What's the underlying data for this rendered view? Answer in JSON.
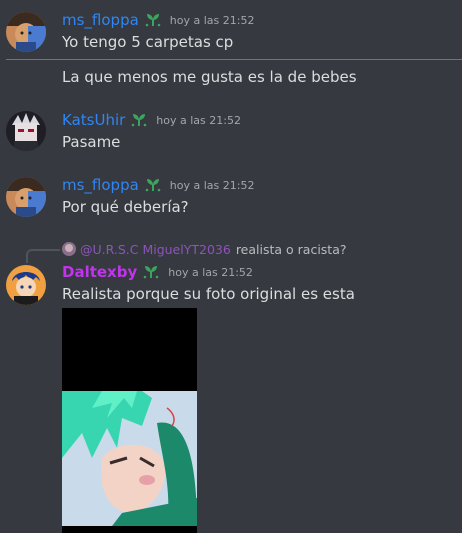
{
  "messages": [
    {
      "username": "ms_floppa",
      "timestamp": "hoy a las 21:52",
      "lines": [
        "Yo tengo 5 carpetas cp",
        "La que menos me gusta es la de bebes"
      ]
    },
    {
      "username": "KatsUhir",
      "timestamp": "hoy a las 21:52",
      "lines": [
        "Pasame"
      ]
    },
    {
      "username": "ms_floppa",
      "timestamp": "hoy a las 21:52",
      "lines": [
        "Por qué debería?"
      ]
    },
    {
      "username": "Daltexby",
      "timestamp": "hoy a las 21:52",
      "lines": [
        "Realista porque su foto original es esta"
      ],
      "reply": {
        "username": "@U.R.S.C MiguelYT2036",
        "text": "realista o racista?"
      }
    }
  ],
  "colors": {
    "background": "#36393f",
    "username_blue": "#2f86f4",
    "username_pink": "#c233ee",
    "new_message_divider": "#d24b4b",
    "badge_green": "#3ba55d"
  },
  "icons": {
    "badge": "leaf-sprout-badge-icon"
  }
}
